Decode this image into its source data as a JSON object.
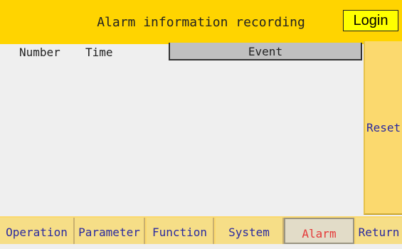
{
  "header": {
    "title": "Alarm information recording",
    "login_label": "Login"
  },
  "table": {
    "columns": [
      "Number",
      "Time",
      "Event"
    ],
    "rows": []
  },
  "side": {
    "reset_label": "Reset"
  },
  "tabs": [
    {
      "label": "Operation",
      "active": false
    },
    {
      "label": "Parameter",
      "active": false
    },
    {
      "label": "Function",
      "active": false
    },
    {
      "label": "System",
      "active": false
    },
    {
      "label": "Alarm",
      "active": true
    },
    {
      "label": "Return",
      "active": false
    }
  ],
  "colors": {
    "header_bg": "#ffd400",
    "login_bg": "#ffff00",
    "panel_bg": "#efefef",
    "event_header_bg": "#c0c0c0",
    "button_bg": "#fbd96e",
    "button_text": "#2a2aa0",
    "active_tab_text": "#e53838"
  }
}
